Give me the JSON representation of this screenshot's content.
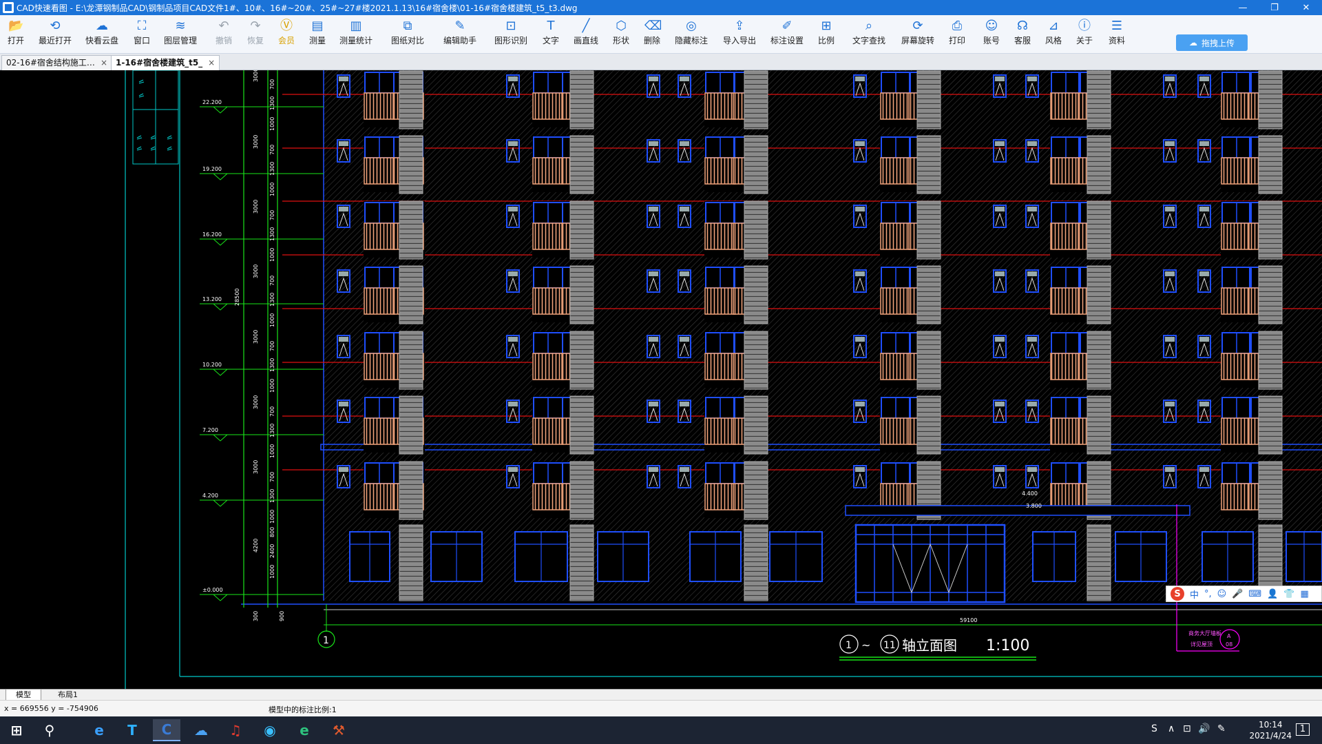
{
  "window": {
    "title": "CAD快速看图 - E:\\龙潭钢制品CAD\\钢制品项目CAD文件1#、10#、16#~20#、25#~27#楼2021.1.13\\16#宿舍楼\\01-16#宿舍楼建筑_t5_t3.dwg",
    "minimize": "—",
    "restore": "❐",
    "close": "✕"
  },
  "toolbar": {
    "items": [
      {
        "label": "打开",
        "icon": "open-folder-icon"
      },
      {
        "label": "最近打开",
        "icon": "recent-icon"
      },
      {
        "label": "快看云盘",
        "icon": "cloud-icon"
      },
      {
        "label": "窗口",
        "icon": "window-icon"
      },
      {
        "label": "图层管理",
        "icon": "layers-icon"
      },
      {
        "label": "撤销",
        "icon": "undo-icon"
      },
      {
        "label": "恢复",
        "icon": "redo-icon"
      },
      {
        "label": "会员",
        "icon": "vip-icon"
      },
      {
        "label": "测量",
        "icon": "measure-icon"
      },
      {
        "label": "测量统计",
        "icon": "measure-stats-icon"
      },
      {
        "label": "图纸对比",
        "icon": "compare-icon"
      },
      {
        "label": "编辑助手",
        "icon": "edit-helper-icon"
      },
      {
        "label": "图形识别",
        "icon": "shape-recognize-icon"
      },
      {
        "label": "文字",
        "icon": "text-icon"
      },
      {
        "label": "画直线",
        "icon": "line-icon"
      },
      {
        "label": "形状",
        "icon": "shape-icon"
      },
      {
        "label": "删除",
        "icon": "eraser-icon"
      },
      {
        "label": "隐藏标注",
        "icon": "hide-annotation-icon"
      },
      {
        "label": "导入导出",
        "icon": "import-export-icon"
      },
      {
        "label": "标注设置",
        "icon": "annotation-settings-icon"
      },
      {
        "label": "比例",
        "icon": "scale-icon"
      },
      {
        "label": "文字查找",
        "icon": "text-search-icon"
      },
      {
        "label": "屏幕旋转",
        "icon": "rotate-screen-icon"
      },
      {
        "label": "打印",
        "icon": "print-icon"
      },
      {
        "label": "账号",
        "icon": "account-icon"
      },
      {
        "label": "客服",
        "icon": "support-icon"
      },
      {
        "label": "风格",
        "icon": "style-icon"
      },
      {
        "label": "关于",
        "icon": "about-icon"
      },
      {
        "label": "资料",
        "icon": "docs-icon"
      }
    ],
    "upload_label": "拖拽上传",
    "vip_badge": "VIP"
  },
  "tabs": [
    {
      "label": "02-16#宿舍结构施工…",
      "close": "×"
    },
    {
      "label": "1-16#宿舍楼建筑_t5_",
      "close": "×"
    }
  ],
  "drawing": {
    "elevations": [
      "22.200",
      "19.200",
      "16.200",
      "13.200",
      "10.200",
      "7.200",
      "4.200",
      "±0.000"
    ],
    "dims_outer": [
      "3000",
      "3000",
      "3000",
      "3000",
      "3000",
      "3000",
      "3000",
      "4200"
    ],
    "dims_inner": [
      "700",
      "1300",
      "1000",
      "700",
      "1300",
      "1000",
      "700",
      "1300",
      "1000",
      "700",
      "1300",
      "1000",
      "700",
      "1300",
      "1000",
      "700",
      "1300",
      "1000",
      "700",
      "1300",
      "1000",
      "800",
      "2400",
      "1000"
    ],
    "total_height": "28500",
    "bottom_dims": [
      "300",
      "900"
    ],
    "total_width": "59100",
    "entrance_levels": [
      "4.400",
      "3.800"
    ],
    "axis_start": "1",
    "axis_end": "11",
    "title_tilde": "~",
    "title_text": "轴立面图",
    "title_scale": "1:100",
    "note_line1": "商务大厅墙板",
    "note_line2": "详见屋顶",
    "note_tag": "A",
    "note_sub": "08"
  },
  "layout_tabs": [
    "模型",
    "布局1"
  ],
  "status": {
    "coords": "x = 669556  y = -754906",
    "scale_text": "模型中的标注比例:1"
  },
  "ime": {
    "logo": "S",
    "mode": "中",
    "punct": "°,",
    "items": [
      "☺",
      "🎤",
      "⌨",
      "👤",
      "👕",
      "▦"
    ]
  },
  "taskbar": {
    "apps": [
      "windows-start-icon",
      "search-icon",
      "ie-icon",
      "t-app-icon",
      "cad-viewer-icon",
      "baidu-netdisk-icon",
      "netease-music-icon",
      "qq-browser-icon",
      "edge-icon",
      "tool-app-icon"
    ],
    "time": "10:14",
    "date": "2021/4/24",
    "notification_count": "1"
  },
  "colors": {
    "titlebar": "#1b73d8",
    "accent": "#1e72d6",
    "window_blue": "#1f4fff",
    "balcony": "#f0a27a",
    "floor_line": "#e01010",
    "dim_green": "#19e619",
    "cyan": "#00d0d0"
  }
}
